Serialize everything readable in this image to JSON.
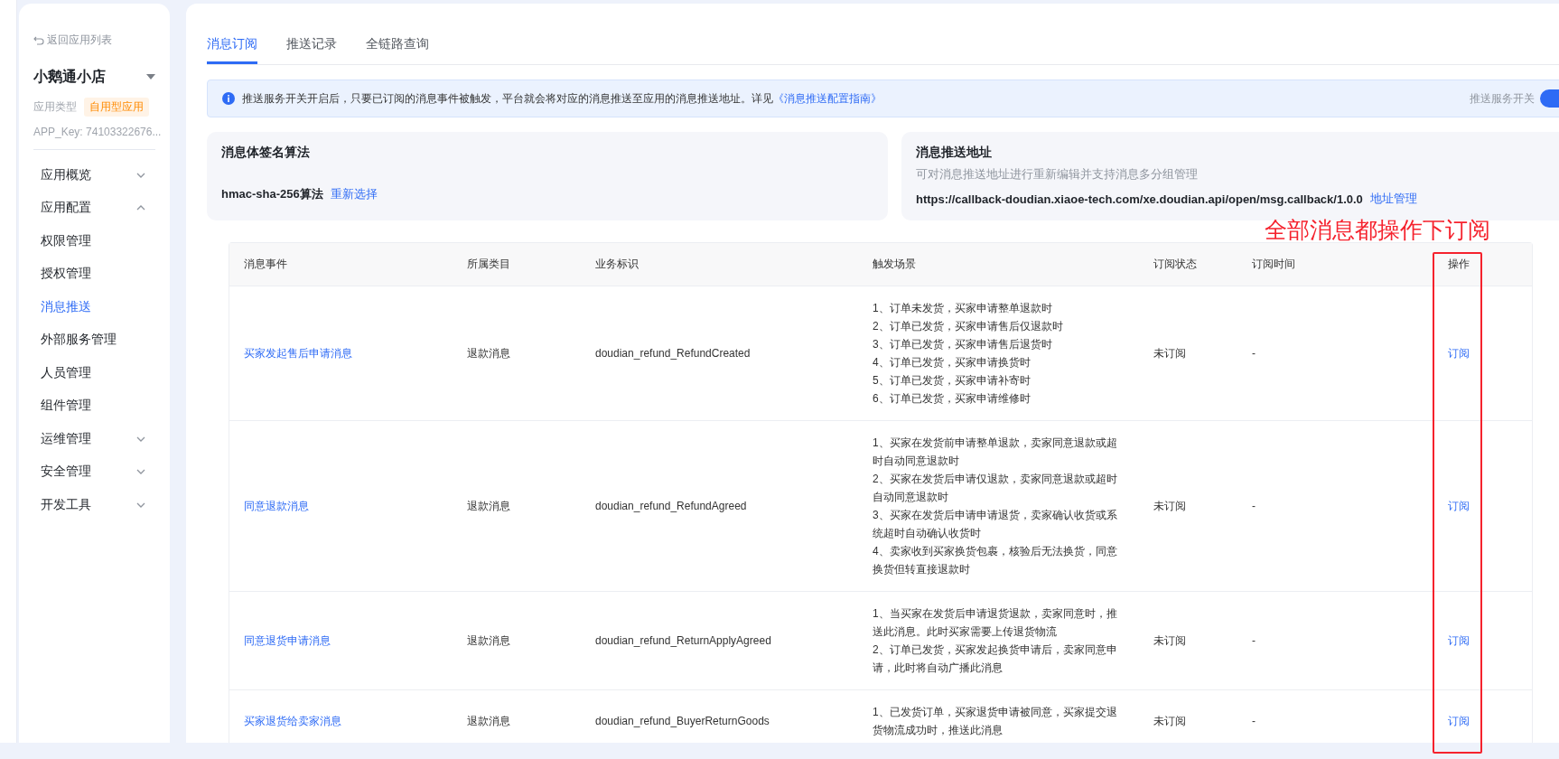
{
  "back_link": "返回应用列表",
  "app": {
    "name": "小鹅通小店",
    "type_label": "应用类型",
    "type_tag": "自用型应用",
    "app_key": "APP_Key: 74103322676..."
  },
  "menu": [
    {
      "label": "应用概览",
      "selected": false,
      "expanded": false
    },
    {
      "label": "应用配置",
      "selected": false,
      "expanded": true,
      "children": [
        {
          "label": "权限管理",
          "selected": false
        },
        {
          "label": "授权管理",
          "selected": false
        },
        {
          "label": "消息推送",
          "selected": true
        },
        {
          "label": "外部服务管理",
          "selected": false
        },
        {
          "label": "人员管理",
          "selected": false
        },
        {
          "label": "组件管理",
          "selected": false
        }
      ]
    },
    {
      "label": "运维管理",
      "selected": false,
      "expanded": false
    },
    {
      "label": "安全管理",
      "selected": false,
      "expanded": false
    },
    {
      "label": "开发工具",
      "selected": false,
      "expanded": false
    }
  ],
  "tabs": [
    {
      "label": "消息订阅",
      "selected": true
    },
    {
      "label": "推送记录",
      "selected": false
    },
    {
      "label": "全链路查询",
      "selected": false
    }
  ],
  "notice": {
    "text": "推送服务开关开启后，只要已订阅的消息事件被触发，平台就会将对应的消息推送至应用的消息推送地址。详见",
    "link": "《消息推送配置指南》",
    "switch_label": "推送服务开关",
    "switch_on": true
  },
  "signature": {
    "title": "消息体签名算法",
    "value": "hmac-sha-256算法",
    "action": "重新选择"
  },
  "push_address": {
    "title": "消息推送地址",
    "description": "可对消息推送地址进行重新编辑并支持消息多分组管理",
    "url": "https://callback-doudian.xiaoe-tech.com/xe.doudian.api/open/msg.callback/1.0.0",
    "action": "地址管理"
  },
  "annotation": {
    "text": "全部消息都操作下订阅"
  },
  "table": {
    "columns": [
      "消息事件",
      "所属类目",
      "业务标识",
      "触发场景",
      "订阅状态",
      "订阅时间",
      "操作"
    ],
    "rows": [
      {
        "event": "买家发起售后申请消息",
        "category": "退款消息",
        "identifier": "doudian_refund_RefundCreated",
        "scenarios": [
          "1、订单未发货，买家申请整单退款时",
          "2、订单已发货，买家申请售后仅退款时",
          "3、订单已发货，买家申请售后退货时",
          "4、订单已发货，买家申请换货时",
          "5、订单已发货，买家申请补寄时",
          "6、订单已发货，买家申请维修时"
        ],
        "status": "未订阅",
        "time": "-",
        "action": "订阅"
      },
      {
        "event": "同意退款消息",
        "category": "退款消息",
        "identifier": "doudian_refund_RefundAgreed",
        "scenarios": [
          "1、买家在发货前申请整单退款，卖家同意退款或超时自动同意退款时",
          "2、买家在发货后申请仅退款，卖家同意退款或超时自动同意退款时",
          "3、买家在发货后申请申请退货，卖家确认收货或系统超时自动确认收货时",
          "4、卖家收到买家换货包裹，核验后无法换货，同意换货但转直接退款时"
        ],
        "status": "未订阅",
        "time": "-",
        "action": "订阅"
      },
      {
        "event": "同意退货申请消息",
        "category": "退款消息",
        "identifier": "doudian_refund_ReturnApplyAgreed",
        "scenarios": [
          "1、当买家在发货后申请退货退款，卖家同意时，推送此消息。此时买家需要上传退货物流",
          "2、订单已发货，买家发起换货申请后，卖家同意申请，此时将自动广播此消息"
        ],
        "status": "未订阅",
        "time": "-",
        "action": "订阅"
      },
      {
        "event": "买家退货给卖家消息",
        "category": "退款消息",
        "identifier": "doudian_refund_BuyerReturnGoods",
        "scenarios": [
          "1、已发货订单，买家退货申请被同意，买家提交退货物流成功时，推送此消息"
        ],
        "status": "未订阅",
        "time": "-",
        "action": "订阅"
      }
    ]
  }
}
